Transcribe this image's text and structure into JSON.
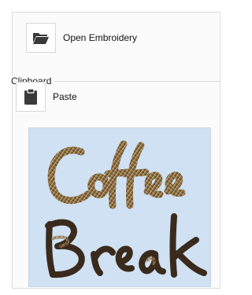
{
  "clipboard": {
    "open_embroidery_label": "Open Embroidery",
    "group_title": "Clipboard",
    "paste_label": "Paste",
    "folder_icon": "folder-icon",
    "paste_icon": "clipboard-paste-icon"
  },
  "preview": {
    "line1": "Coffee",
    "line2": "Break",
    "background": "#cfe1f3",
    "thread_colors": [
      "#8a6a3a",
      "#c7a66d",
      "#3a2a1c",
      "#e6d8bb"
    ]
  }
}
